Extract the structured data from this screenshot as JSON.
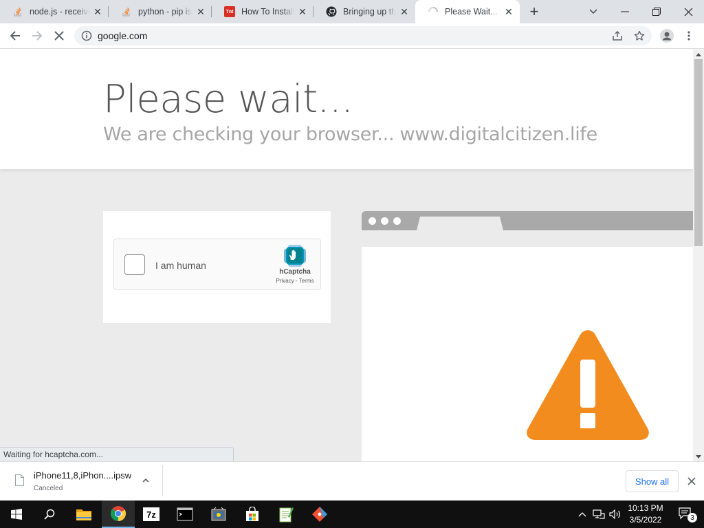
{
  "browser": {
    "tabs": [
      {
        "title": "node.js - receiving",
        "favicon": "stackoverflow-icon",
        "active": false
      },
      {
        "title": "python - pip issue",
        "favicon": "stackoverflow-icon",
        "active": false
      },
      {
        "title": "How To Install A",
        "favicon": "tnt-icon",
        "favicon_text": "Tnt",
        "active": false
      },
      {
        "title": "Bringing up the",
        "favicon": "github-icon",
        "active": false
      },
      {
        "title": "Please Wait... | C",
        "favicon": "loading-spinner-icon",
        "active": true
      }
    ],
    "address": {
      "url": "google.com"
    }
  },
  "page": {
    "title": "Please wait...",
    "subtitle": "We are checking your browser... www.digitalcitizen.life",
    "captcha": {
      "label": "I am human",
      "brand": "hCaptcha",
      "links": "Privacy - Terms"
    }
  },
  "status_bar": {
    "text": "Waiting for hcaptcha.com..."
  },
  "downloads": {
    "items": [
      {
        "name": "iPhone11,8,iPhon....ipsw",
        "state": "Canceled"
      }
    ],
    "show_all_label": "Show all"
  },
  "taskbar": {
    "apps": [
      "start-icon",
      "search-icon",
      "file-explorer-icon",
      "chrome-icon",
      "7zip-icon",
      "terminal-icon",
      "app-icon",
      "store-icon",
      "notepad-icon",
      "git-icon"
    ],
    "app_7z_text": "7z",
    "clock_time": "10:13 PM",
    "clock_date": "3/5/2022",
    "notification_count": "3"
  },
  "colors": {
    "warning": "#f28c1f",
    "link": "#1a73e8",
    "hcaptcha_teal": "#00838f"
  }
}
